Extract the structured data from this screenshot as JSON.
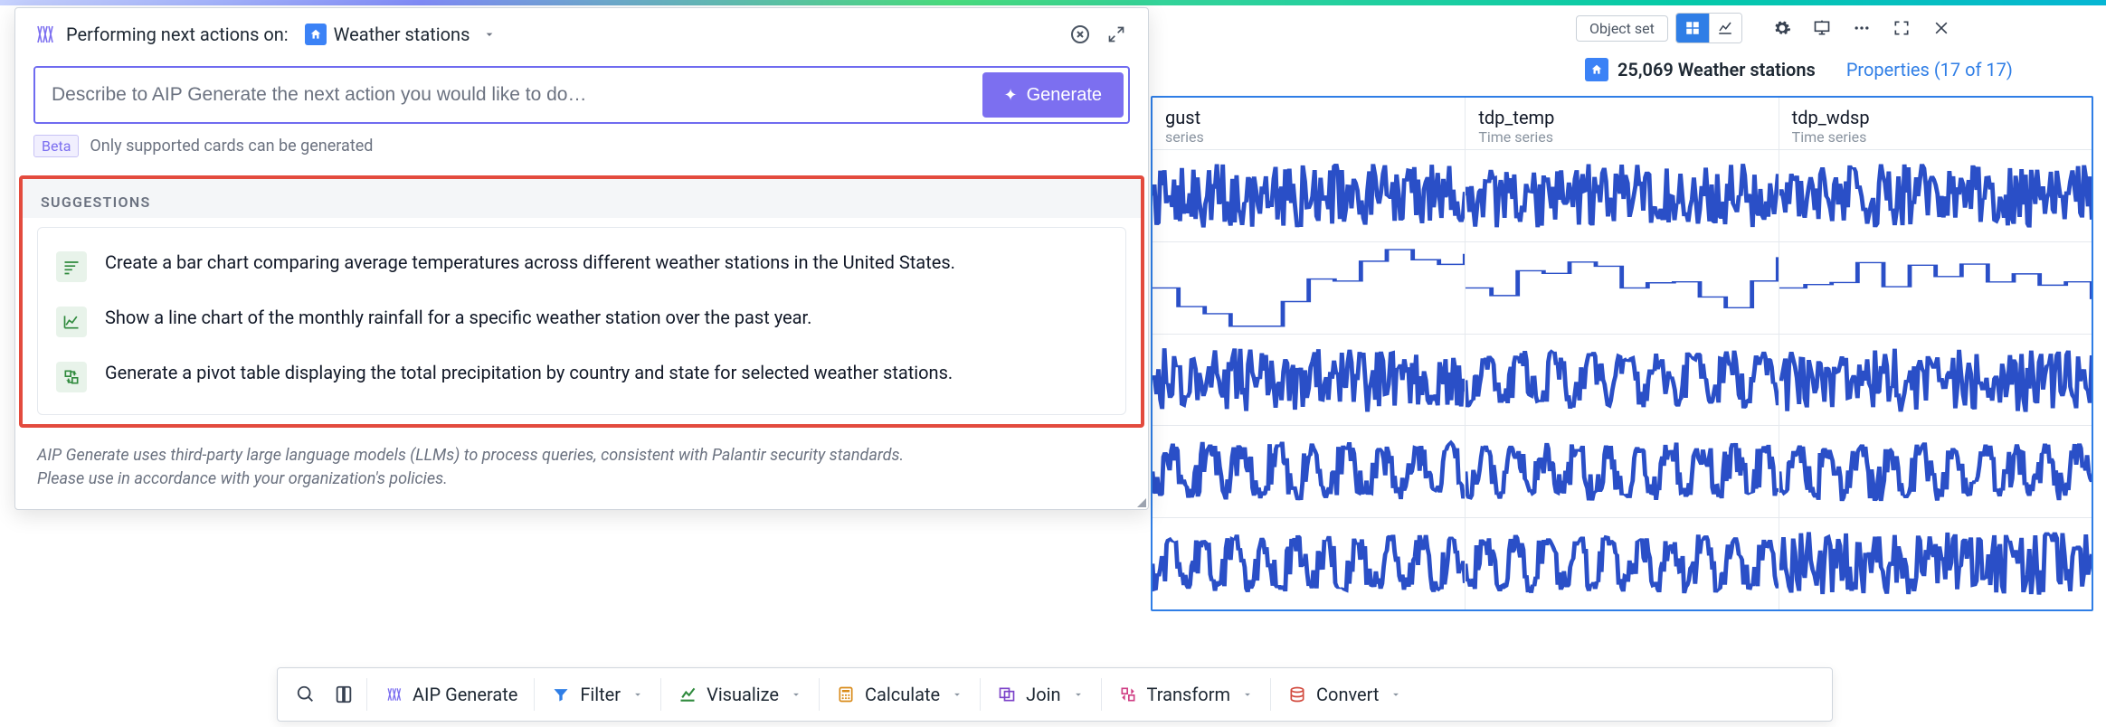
{
  "aip": {
    "header_label": "Performing next actions on:",
    "object_type": "Weather stations",
    "input_placeholder": "Describe to AIP Generate the next action you would like to do…",
    "generate_label": "Generate",
    "beta_label": "Beta",
    "support_note": "Only supported cards can be generated",
    "suggestions_title": "SUGGESTIONS",
    "suggestions": [
      {
        "kind": "bar",
        "text": "Create a bar chart comparing average temperatures across different weather stations in the United States."
      },
      {
        "kind": "line",
        "text": "Show a line chart of the monthly rainfall for a specific weather station over the past year."
      },
      {
        "kind": "pivot",
        "text": "Generate a pivot table displaying the total precipitation by country and state for selected weather stations."
      }
    ],
    "footer_line1": "AIP Generate uses third-party large language models (LLMs) to process queries, consistent with Palantir security standards.",
    "footer_line2": "Please use in accordance with your organization's policies."
  },
  "workspace": {
    "object_set_label": "Object set",
    "count_text": "25,069 Weather stations",
    "properties_link": "Properties (17 of 17)",
    "columns": [
      {
        "title": "gust",
        "subtitle": "series",
        "title_clipped": true
      },
      {
        "title": "tdp_temp",
        "subtitle": "Time series",
        "title_clipped": false
      },
      {
        "title": "tdp_wdsp",
        "subtitle": "Time series",
        "title_clipped": false
      }
    ],
    "rows_per_column": 5
  },
  "toolbar": {
    "aip_generate": "AIP Generate",
    "filter": "Filter",
    "visualize": "Visualize",
    "calculate": "Calculate",
    "join": "Join",
    "transform": "Transform",
    "convert": "Convert"
  }
}
